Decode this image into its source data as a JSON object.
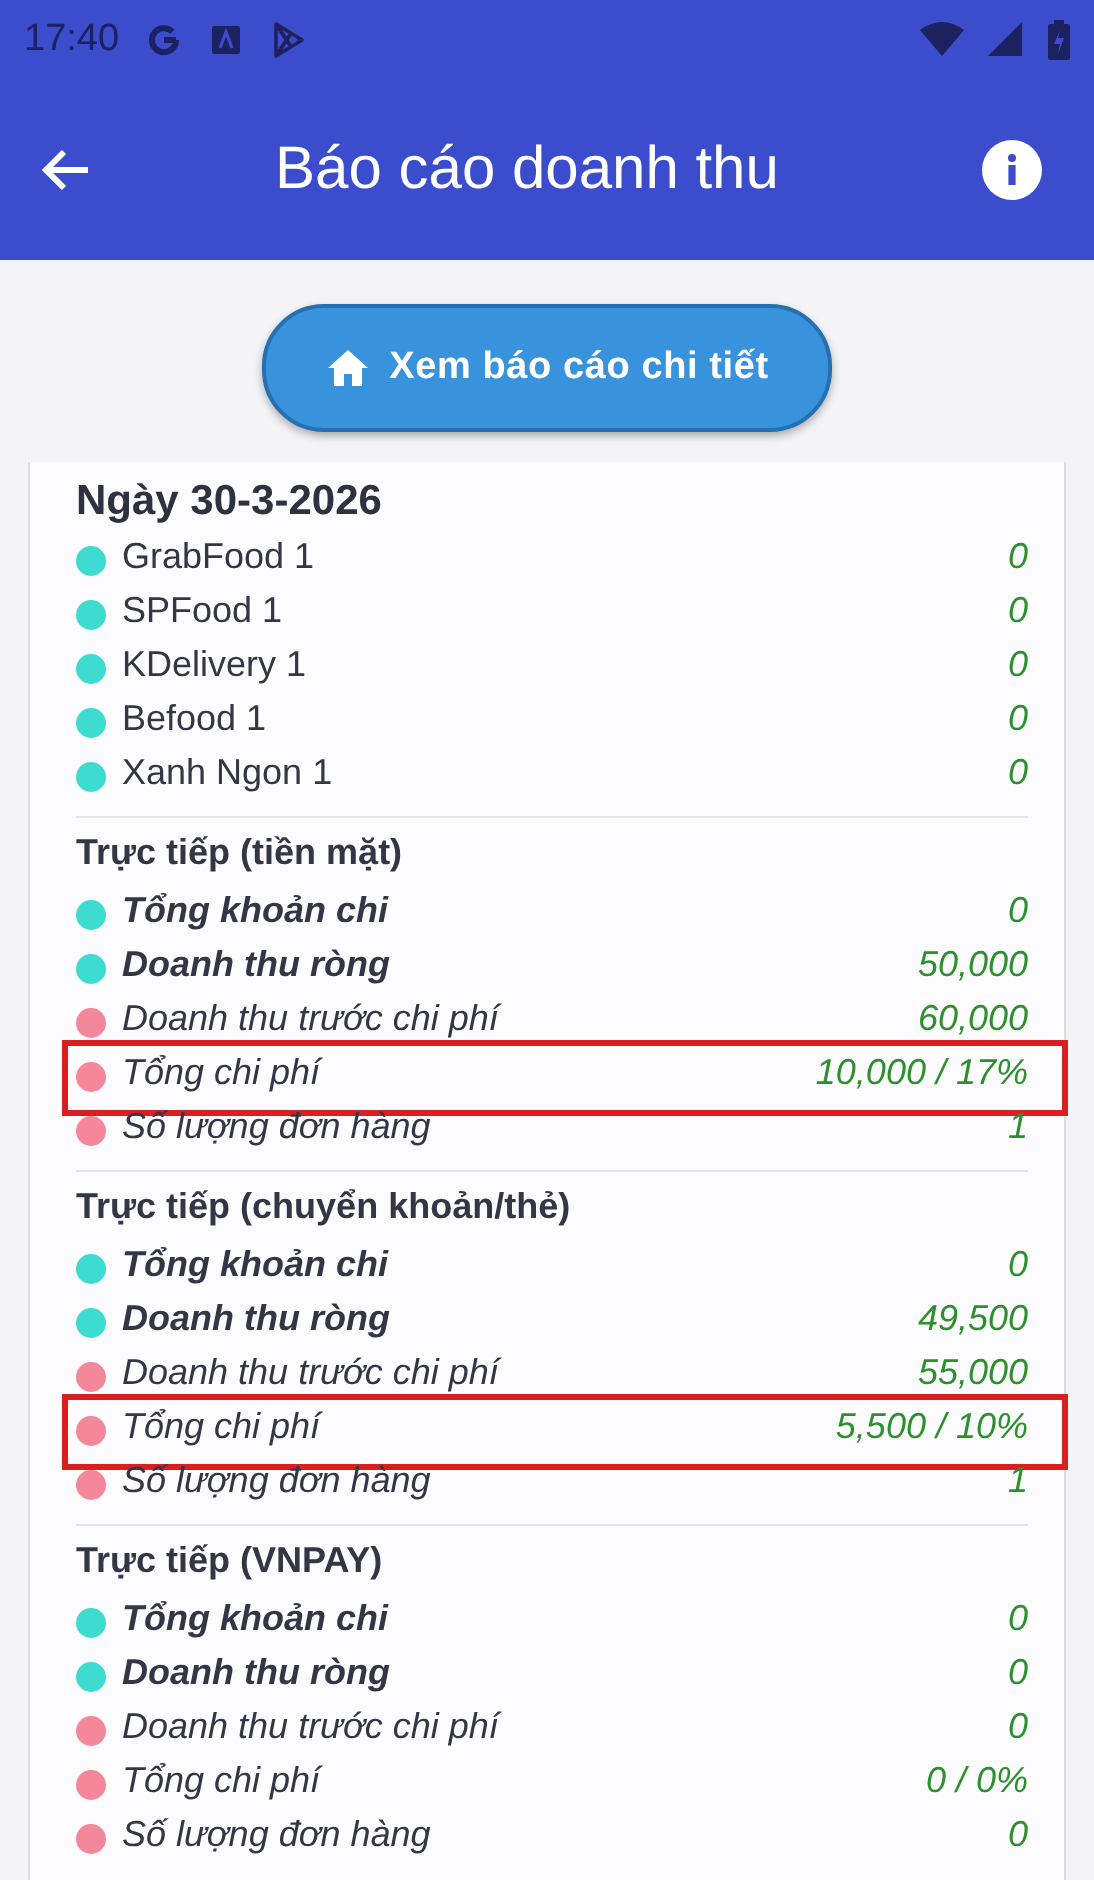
{
  "status_bar": {
    "time": "17:40"
  },
  "app_bar": {
    "title": "Báo cáo doanh thu"
  },
  "detail_button": {
    "label": "Xem báo cáo chi tiết"
  },
  "report": {
    "date": "Ngày 30-3-2026",
    "channels": [
      {
        "label": "GrabFood 1",
        "value": "0",
        "color": "#3ddbd0"
      },
      {
        "label": "SPFood 1",
        "value": "0",
        "color": "#3ddbd0"
      },
      {
        "label": "KDelivery 1",
        "value": "0",
        "color": "#3ddbd0"
      },
      {
        "label": "Befood 1",
        "value": "0",
        "color": "#3ddbd0"
      },
      {
        "label": "Xanh Ngon 1",
        "value": "0",
        "color": "#3ddbd0"
      }
    ],
    "sections": [
      {
        "title": "Trực tiếp (tiền mặt)",
        "rows": [
          {
            "label": "Tổng khoản chi",
            "value": "0",
            "kind": "bold",
            "color": "#3ddbd0",
            "highlighted": false
          },
          {
            "label": "Doanh thu ròng",
            "value": "50,000",
            "kind": "bold",
            "color": "#3ddbd0",
            "highlighted": false
          },
          {
            "label": "Doanh thu trước chi phí",
            "value": "60,000",
            "kind": "italic",
            "color": "#f4879a",
            "highlighted": false
          },
          {
            "label": "Tổng chi phí",
            "value": "10,000 / 17%",
            "kind": "italic",
            "color": "#f4879a",
            "highlighted": true
          },
          {
            "label": "Số lượng đơn hàng",
            "value": "1",
            "kind": "italic",
            "color": "#f4879a",
            "highlighted": false
          }
        ]
      },
      {
        "title": "Trực tiếp (chuyển khoản/thẻ)",
        "rows": [
          {
            "label": "Tổng khoản chi",
            "value": "0",
            "kind": "bold",
            "color": "#3ddbd0",
            "highlighted": false
          },
          {
            "label": "Doanh thu ròng",
            "value": "49,500",
            "kind": "bold",
            "color": "#3ddbd0",
            "highlighted": false
          },
          {
            "label": "Doanh thu trước chi phí",
            "value": "55,000",
            "kind": "italic",
            "color": "#f4879a",
            "highlighted": false
          },
          {
            "label": "Tổng chi phí",
            "value": "5,500 / 10%",
            "kind": "italic",
            "color": "#f4879a",
            "highlighted": true
          },
          {
            "label": "Số lượng đơn hàng",
            "value": "1",
            "kind": "italic",
            "color": "#f4879a",
            "highlighted": false
          }
        ]
      },
      {
        "title": "Trực tiếp (VNPAY)",
        "rows": [
          {
            "label": "Tổng khoản chi",
            "value": "0",
            "kind": "bold",
            "color": "#3ddbd0",
            "highlighted": false
          },
          {
            "label": "Doanh thu ròng",
            "value": "0",
            "kind": "bold",
            "color": "#3ddbd0",
            "highlighted": false
          },
          {
            "label": "Doanh thu trước chi phí",
            "value": "0",
            "kind": "italic",
            "color": "#f4879a",
            "highlighted": false
          },
          {
            "label": "Tổng chi phí",
            "value": "0 / 0%",
            "kind": "italic",
            "color": "#f4879a",
            "highlighted": false
          },
          {
            "label": "Số lượng đơn hàng",
            "value": "0",
            "kind": "italic",
            "color": "#f4879a",
            "highlighted": false
          }
        ]
      }
    ]
  }
}
